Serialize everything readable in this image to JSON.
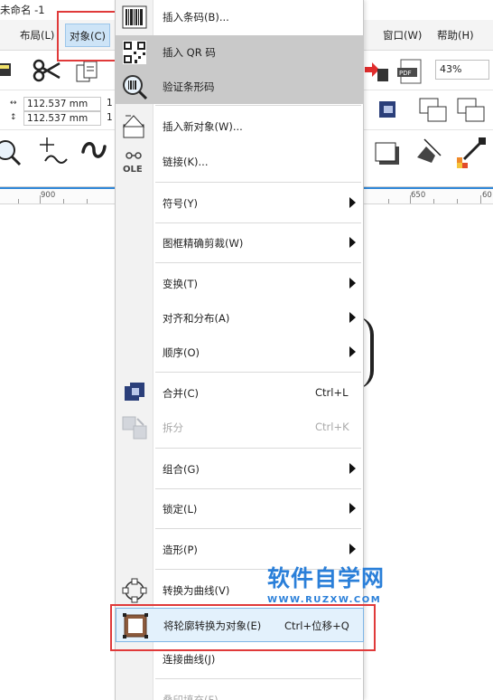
{
  "window": {
    "title": "未命名 -1"
  },
  "menubar": {
    "items": [
      {
        "label": "布局(L)"
      },
      {
        "label": "对象(C)"
      },
      {
        "label": "窗口(W)"
      },
      {
        "label": "帮助(H)"
      }
    ]
  },
  "toolbar": {
    "zoom": "43%",
    "width_value": "112.537 mm",
    "height_value": "112.537 mm",
    "dim_prefix_1": "1",
    "dim_prefix_2": "1"
  },
  "ruler": {
    "labels": [
      "900",
      "650",
      "60"
    ]
  },
  "dropdown": {
    "items": [
      {
        "label": "插入条码(B)...",
        "icon": "barcode-icon"
      },
      {
        "label": "插入 QR 码",
        "icon": "qr-code-icon"
      },
      {
        "label": "验证条形码",
        "icon": "verify-barcode-icon"
      },
      {
        "label": "插入新对象(W)...",
        "icon": "insert-object-icon"
      },
      {
        "label": "链接(K)...",
        "icon": "ole-icon",
        "icon_text": "OLE"
      },
      {
        "label": "符号(Y)"
      },
      {
        "label": "图框精确剪裁(W)"
      },
      {
        "label": "变换(T)"
      },
      {
        "label": "对齐和分布(A)"
      },
      {
        "label": "顺序(O)"
      },
      {
        "label": "合并(C)",
        "shortcut": "Ctrl+L",
        "icon": "combine-icon"
      },
      {
        "label": "拆分",
        "shortcut": "Ctrl+K",
        "icon": "break-apart-icon"
      },
      {
        "label": "组合(G)"
      },
      {
        "label": "锁定(L)"
      },
      {
        "label": "造形(P)"
      },
      {
        "label": "转换为曲线(V)",
        "icon": "convert-to-curves-icon"
      },
      {
        "label": "将轮廓转换为对象(E)",
        "shortcut": "Ctrl+位移+Q",
        "icon": "outline-to-object-icon"
      },
      {
        "label": "连接曲线(J)"
      },
      {
        "label": "叠印填充(F)"
      }
    ]
  },
  "watermark": {
    "title": "软件自学网",
    "url": "WWW.RUZXW.COM"
  },
  "colors": {
    "highlight_red": "#e03a3a",
    "selection_blue": "#e3f1fc",
    "accent_blue": "#2a7fd9"
  }
}
